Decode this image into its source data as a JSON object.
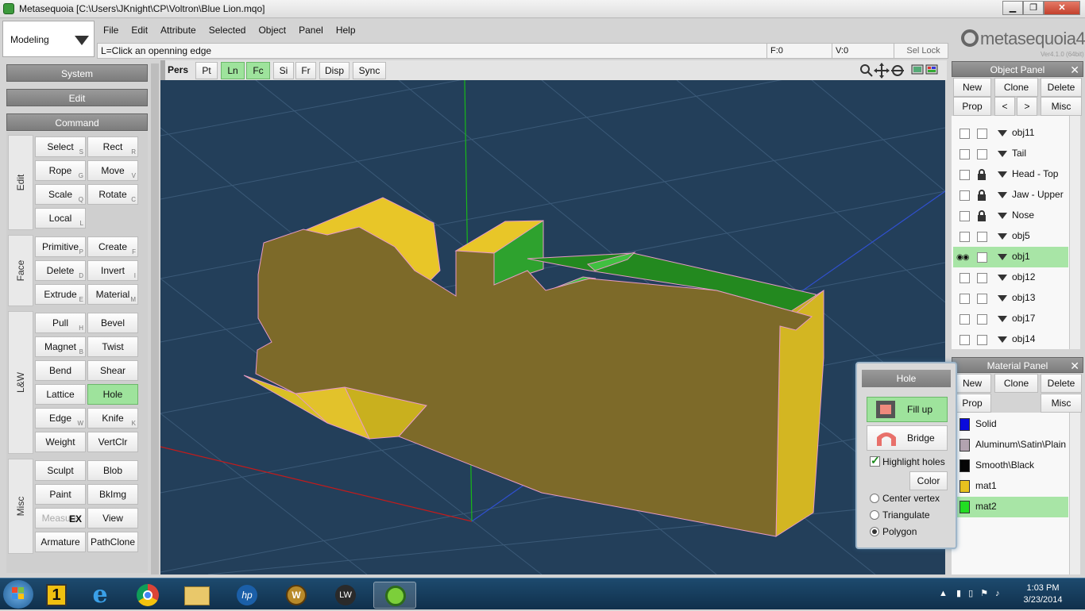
{
  "window": {
    "title": "Metasequoia [C:\\Users\\JKnight\\CP\\Voltron\\Blue Lion.mqo]",
    "minimize": "▁",
    "maximize": "❐",
    "close": "✕"
  },
  "mode": {
    "value": "Modeling"
  },
  "menu": [
    "File",
    "Edit",
    "Attribute",
    "Selected",
    "Object",
    "Panel",
    "Help"
  ],
  "status": {
    "message": "L=Click an openning edge",
    "faces": "F:0",
    "vertices": "V:0",
    "sel_lock": "Sel Lock"
  },
  "logo": {
    "text": "metasequoia4",
    "version": "Ver4.1.0 (64bit)"
  },
  "left_panel": {
    "system": "System",
    "edit": "Edit",
    "command": "Command",
    "groups": [
      "Edit",
      "Face",
      "L&W",
      "Misc"
    ],
    "buttons": [
      {
        "label": "Select",
        "key": "S"
      },
      {
        "label": "Rect",
        "key": "R"
      },
      {
        "label": "Rope",
        "key": "G"
      },
      {
        "label": "Move",
        "key": "V"
      },
      {
        "label": "Scale",
        "key": "Q"
      },
      {
        "label": "Rotate",
        "key": "C"
      },
      {
        "label": "Local",
        "key": "L"
      },
      {
        "label": "Primitive",
        "key": "P"
      },
      {
        "label": "Create",
        "key": "F"
      },
      {
        "label": "Delete",
        "key": "D"
      },
      {
        "label": "Invert",
        "key": "I"
      },
      {
        "label": "Extrude",
        "key": "E"
      },
      {
        "label": "Material",
        "key": "M"
      },
      {
        "label": "Pull",
        "key": "H"
      },
      {
        "label": "Bevel",
        "key": ""
      },
      {
        "label": "Magnet",
        "key": "B"
      },
      {
        "label": "Twist",
        "key": ""
      },
      {
        "label": "Bend",
        "key": ""
      },
      {
        "label": "Shear",
        "key": ""
      },
      {
        "label": "Lattice",
        "key": ""
      },
      {
        "label": "Hole",
        "key": ""
      },
      {
        "label": "Edge",
        "key": "W"
      },
      {
        "label": "Knife",
        "key": "K"
      },
      {
        "label": "Weight",
        "key": ""
      },
      {
        "label": "VertClr",
        "key": ""
      },
      {
        "label": "Sculpt",
        "key": ""
      },
      {
        "label": "Blob",
        "key": ""
      },
      {
        "label": "Paint",
        "key": ""
      },
      {
        "label": "BkImg",
        "key": ""
      },
      {
        "label": "Measure",
        "key": "EX"
      },
      {
        "label": "View",
        "key": ""
      },
      {
        "label": "Armature",
        "key": ""
      },
      {
        "label": "PathClone",
        "key": ""
      }
    ]
  },
  "view_toolbar": [
    "Pers",
    "Pt",
    "Ln",
    "Fc",
    "Si",
    "Fr",
    "Disp",
    "Sync"
  ],
  "object_panel": {
    "title": "Object Panel",
    "new": "New",
    "clone": "Clone",
    "delete": "Delete",
    "prop": "Prop",
    "prev": "<",
    "next": ">",
    "misc": "Misc",
    "objects": [
      "obj11",
      "Tail",
      "Head - Top",
      "Jaw - Upper",
      "Nose",
      "obj5",
      "obj1",
      "obj12",
      "obj13",
      "obj17",
      "obj14"
    ]
  },
  "material_panel": {
    "title": "Material Panel",
    "new": "New",
    "clone": "Clone",
    "delete": "Delete",
    "prop": "Prop",
    "misc": "Misc",
    "materials": [
      {
        "name": "Solid",
        "color": "#0a0adc"
      },
      {
        "name": "Aluminum\\Satin\\Plain",
        "color": "#b3a3b0"
      },
      {
        "name": "Smooth\\Black",
        "color": "#050505"
      },
      {
        "name": "mat1",
        "color": "#e8c21f"
      },
      {
        "name": "mat2",
        "color": "#22dd22"
      }
    ]
  },
  "hole_dialog": {
    "title": "Hole",
    "fill_up": "Fill up",
    "bridge": "Bridge",
    "highlight": "Highlight holes",
    "color": "Color",
    "center_vertex": "Center vertex",
    "triangulate": "Triangulate",
    "polygon": "Polygon"
  },
  "taskbar": {
    "time": "1:03 PM",
    "date": "3/23/2014"
  }
}
